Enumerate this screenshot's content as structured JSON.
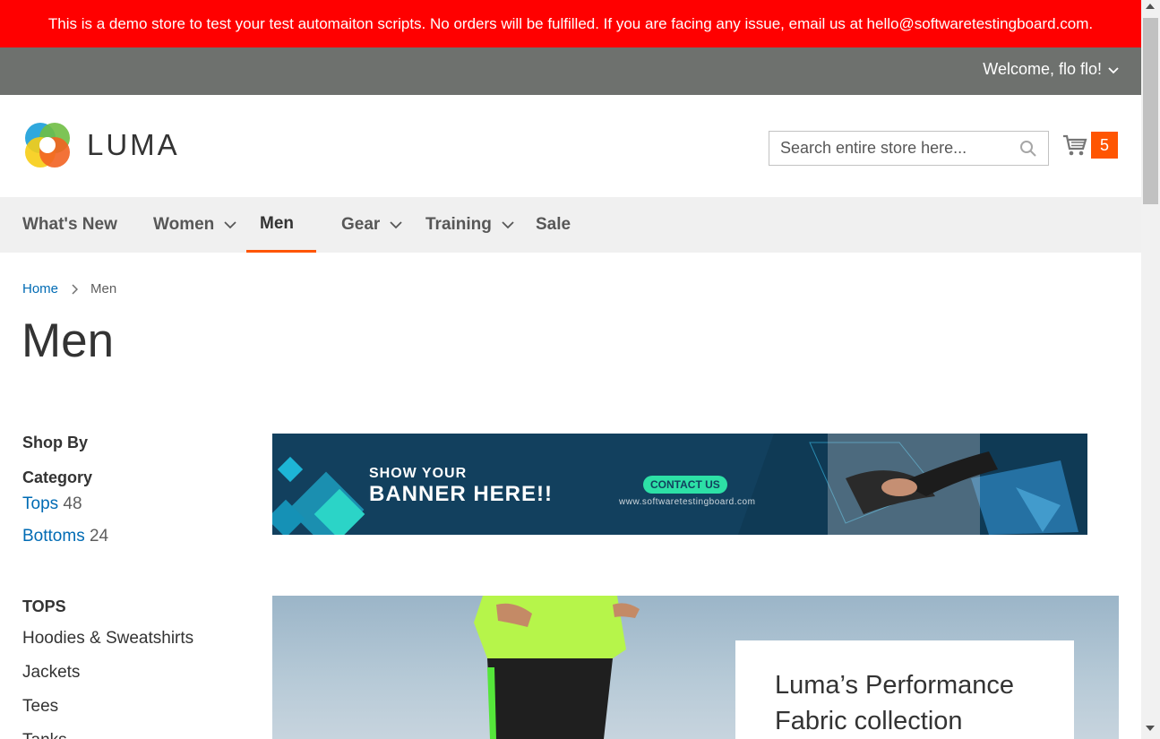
{
  "notice": {
    "text": "This is a demo store to test your test automaiton scripts. No orders will be fulfilled. If you are facing any issue, email us at hello@softwaretestingboard.com."
  },
  "panel": {
    "welcome": "Welcome, flo flo!"
  },
  "header": {
    "logo_text": "LUMA",
    "search_placeholder": "Search entire store here...",
    "cart_count": "5"
  },
  "nav": {
    "items": [
      {
        "label": "What's New",
        "has_dropdown": false
      },
      {
        "label": "Women",
        "has_dropdown": true
      },
      {
        "label": "Men",
        "has_dropdown": true,
        "active": true
      },
      {
        "label": "Gear",
        "has_dropdown": true
      },
      {
        "label": "Training",
        "has_dropdown": true
      },
      {
        "label": "Sale",
        "has_dropdown": false
      }
    ]
  },
  "breadcrumb": {
    "home": "Home",
    "current": "Men"
  },
  "page_title": "Men",
  "sidebar": {
    "title": "Shop By",
    "filter_title": "Category",
    "filters": [
      {
        "label": "Tops",
        "count": "48"
      },
      {
        "label": "Bottoms",
        "count": "24"
      }
    ],
    "group_title": "TOPS",
    "group_items": [
      "Hoodies & Sweatshirts",
      "Jackets",
      "Tees",
      "Tanks"
    ]
  },
  "banner": {
    "line1": "SHOW YOUR",
    "line2": "BANNER HERE!!",
    "button": "CONTACT US",
    "url": "www.softwaretestingboard.com"
  },
  "hero": {
    "title_line1": "Luma’s Performance",
    "title_line2": "Fabric collection"
  },
  "colors": {
    "notice_bg": "#ff0000",
    "panel_bg": "#6e716e",
    "accent": "#ff5501",
    "link": "#006bb4",
    "banner_bg": "#12405e"
  }
}
